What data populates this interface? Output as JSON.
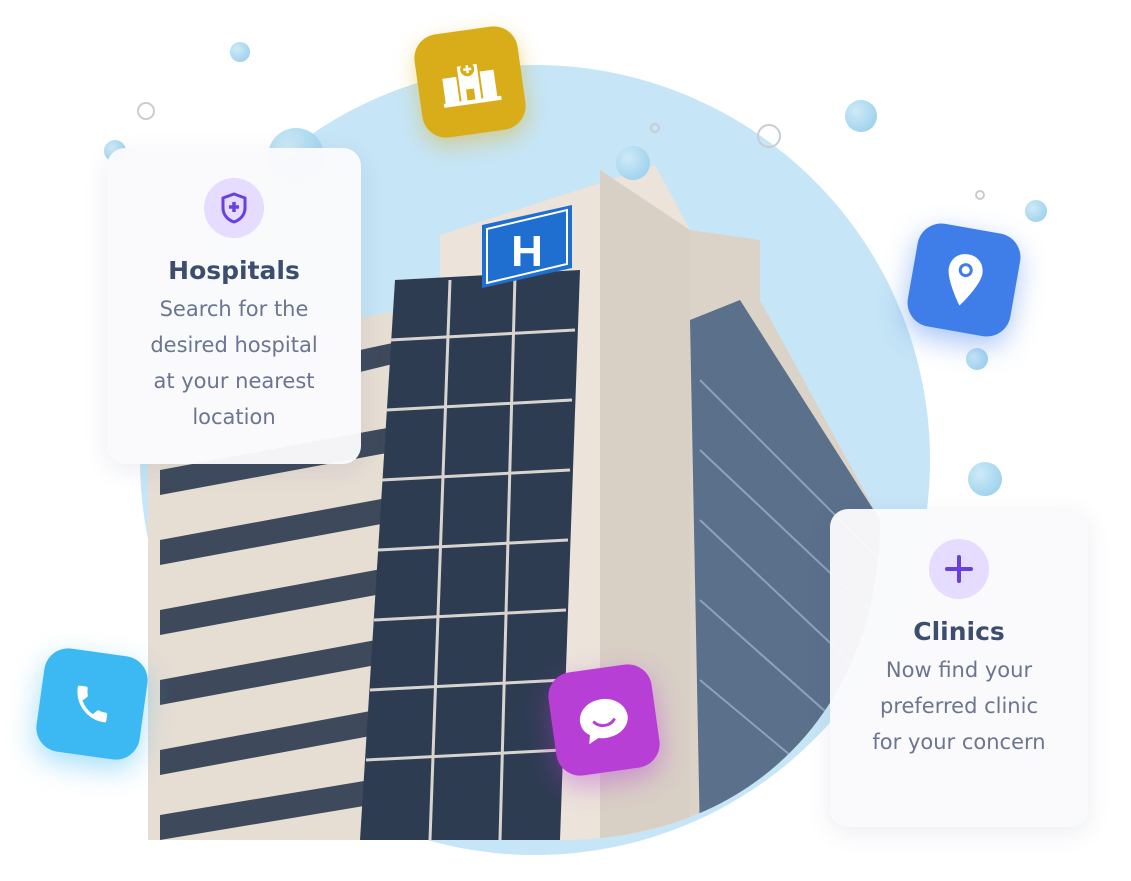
{
  "cards": {
    "hospitals": {
      "title": "Hospitals",
      "lines": [
        "Search for the",
        "desired hospital",
        "at your nearest",
        "location"
      ],
      "icon": "shield-plus-icon"
    },
    "clinics": {
      "title": "Clinics",
      "lines": [
        "Now find your",
        "preferred clinic",
        "for your concern"
      ],
      "icon": "plus-icon"
    }
  },
  "sign_letter": "H",
  "tiles": [
    {
      "icon": "hospital-building-icon",
      "color": "#d9ad1a"
    },
    {
      "icon": "location-pin-icon",
      "color": "#3f7ee8"
    },
    {
      "icon": "phone-icon",
      "color": "#3cb8f2"
    },
    {
      "icon": "chat-bubble-icon",
      "color": "#b83fd6"
    }
  ],
  "colors": {
    "blob": "#c6e5f6",
    "accent_purple": "#6a3fe0",
    "card_title": "#3d4d6e",
    "card_text": "#6a7590"
  }
}
